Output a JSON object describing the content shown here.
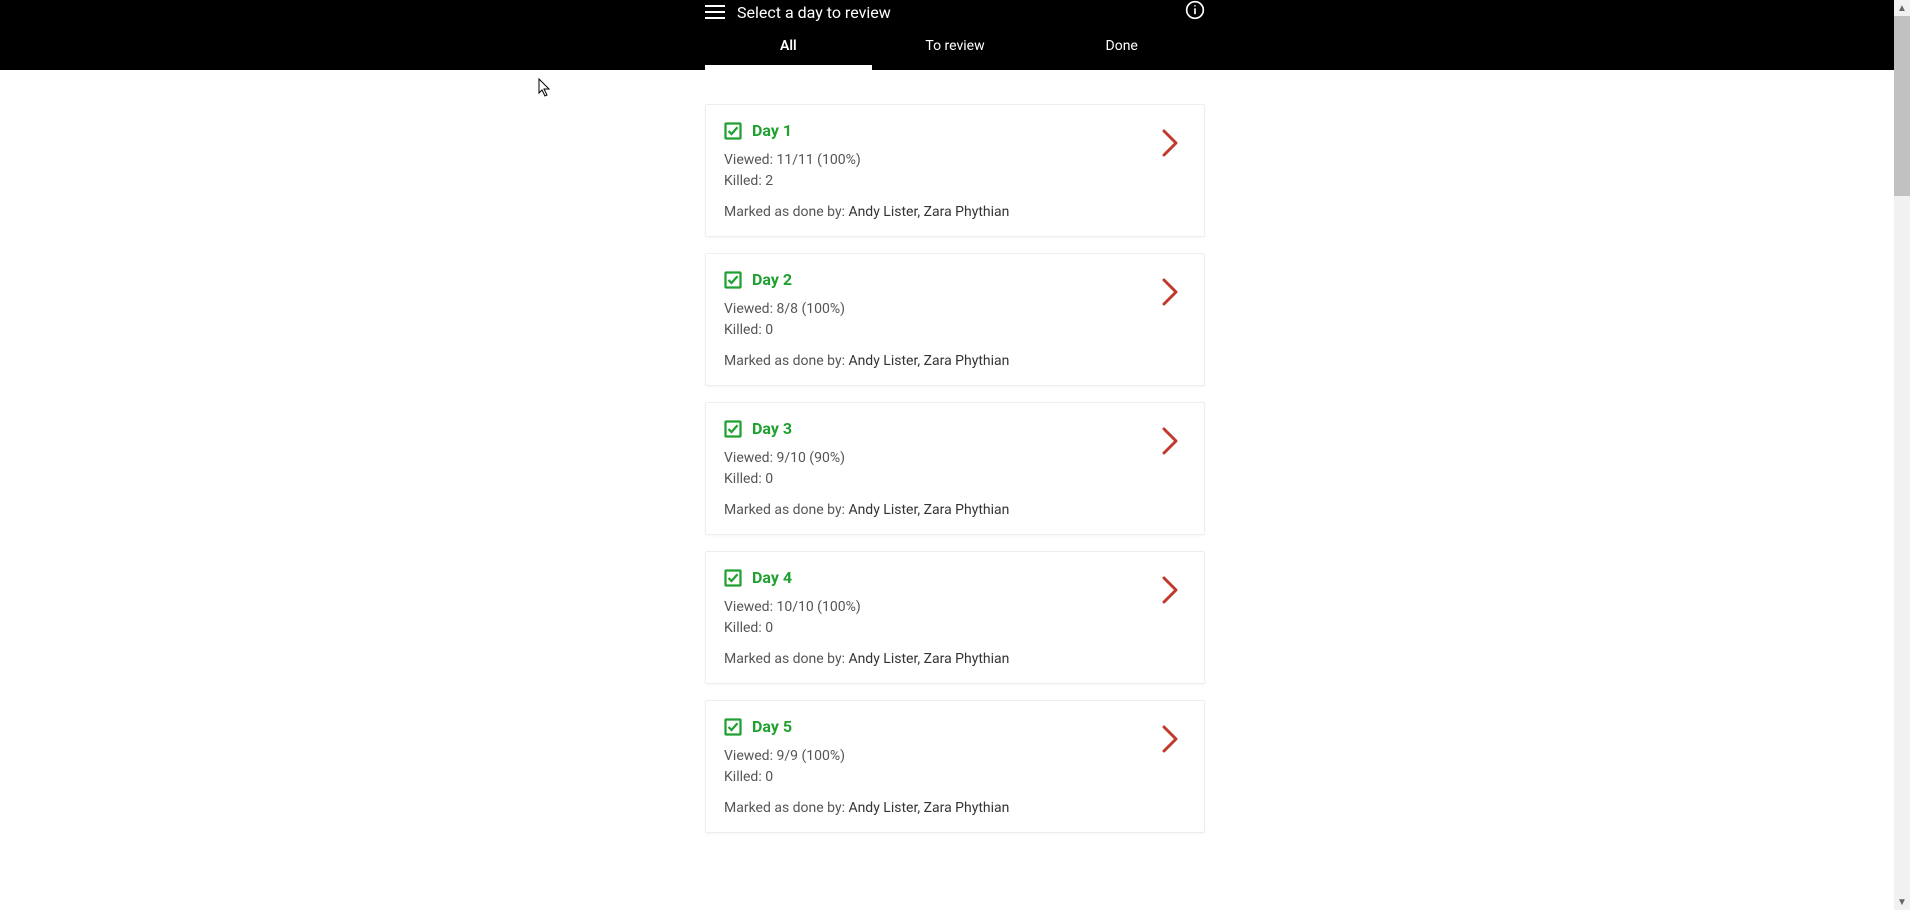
{
  "header": {
    "title": "Select a day to review"
  },
  "tabs": {
    "all": "All",
    "to_review": "To review",
    "done": "Done"
  },
  "labels": {
    "viewed_prefix": "Viewed: ",
    "killed_prefix": "Killed: ",
    "marked_prefix": "Marked as done by: "
  },
  "days": [
    {
      "title": "Day 1",
      "viewed": "11/11 (100%)",
      "killed": "2",
      "marked_by": "Andy Lister, Zara Phythian"
    },
    {
      "title": "Day 2",
      "viewed": "8/8 (100%)",
      "killed": "0",
      "marked_by": "Andy Lister, Zara Phythian"
    },
    {
      "title": "Day 3",
      "viewed": "9/10 (90%)",
      "killed": "0",
      "marked_by": "Andy Lister, Zara Phythian"
    },
    {
      "title": "Day 4",
      "viewed": "10/10 (100%)",
      "killed": "0",
      "marked_by": "Andy Lister, Zara Phythian"
    },
    {
      "title": "Day 5",
      "viewed": "9/9 (100%)",
      "killed": "0",
      "marked_by": "Andy Lister, Zara Phythian"
    }
  ],
  "colors": {
    "green": "#1fa030",
    "red": "#c0392b"
  }
}
